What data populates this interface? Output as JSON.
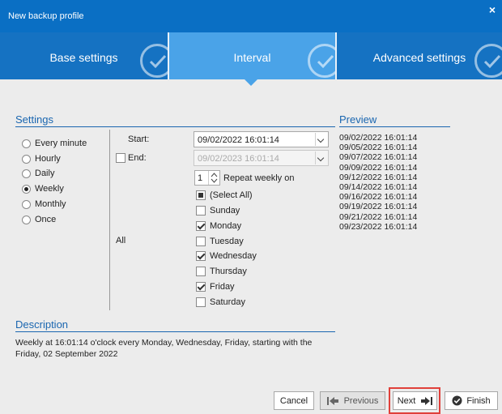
{
  "window": {
    "title": "New backup profile",
    "close_label": "×"
  },
  "tabs": [
    {
      "label": "Base settings",
      "active": false
    },
    {
      "label": "Interval",
      "active": true
    },
    {
      "label": "Advanced settings",
      "active": false
    }
  ],
  "settings": {
    "heading": "Settings",
    "intervals": [
      {
        "label": "Every minute",
        "selected": false
      },
      {
        "label": "Hourly",
        "selected": false
      },
      {
        "label": "Daily",
        "selected": false
      },
      {
        "label": "Weekly",
        "selected": true
      },
      {
        "label": "Monthly",
        "selected": false
      },
      {
        "label": "Once",
        "selected": false
      }
    ],
    "start_label": "Start:",
    "start_value": "09/02/2022 16:01:14",
    "end_label": "End:",
    "end_value": "09/02/2023 16:01:14",
    "end_checked": false,
    "repeat_value": "1",
    "repeat_label": "Repeat weekly on",
    "all_label": "All",
    "days": [
      {
        "label": "(Select All)",
        "state": "partial"
      },
      {
        "label": "Sunday",
        "state": "off"
      },
      {
        "label": "Monday",
        "state": "on"
      },
      {
        "label": "Tuesday",
        "state": "off"
      },
      {
        "label": "Wednesday",
        "state": "on"
      },
      {
        "label": "Thursday",
        "state": "off"
      },
      {
        "label": "Friday",
        "state": "on"
      },
      {
        "label": "Saturday",
        "state": "off"
      }
    ]
  },
  "preview": {
    "heading": "Preview",
    "items": [
      "09/02/2022 16:01:14",
      "09/05/2022 16:01:14",
      "09/07/2022 16:01:14",
      "09/09/2022 16:01:14",
      "09/12/2022 16:01:14",
      "09/14/2022 16:01:14",
      "09/16/2022 16:01:14",
      "09/19/2022 16:01:14",
      "09/21/2022 16:01:14",
      "09/23/2022 16:01:14"
    ]
  },
  "description": {
    "heading": "Description",
    "text": "Weekly at 16:01:14 o'clock every Monday, Wednesday, Friday, starting with the Friday, 02 September 2022"
  },
  "buttons": {
    "cancel": "Cancel",
    "previous": "Previous",
    "next": "Next",
    "finish": "Finish"
  },
  "colors": {
    "title_bar": "#0a6fc4",
    "tab": "#1572c2",
    "tab_active": "#4aa3e8",
    "section_heading": "#1a66b0",
    "highlight": "#e0403a"
  }
}
